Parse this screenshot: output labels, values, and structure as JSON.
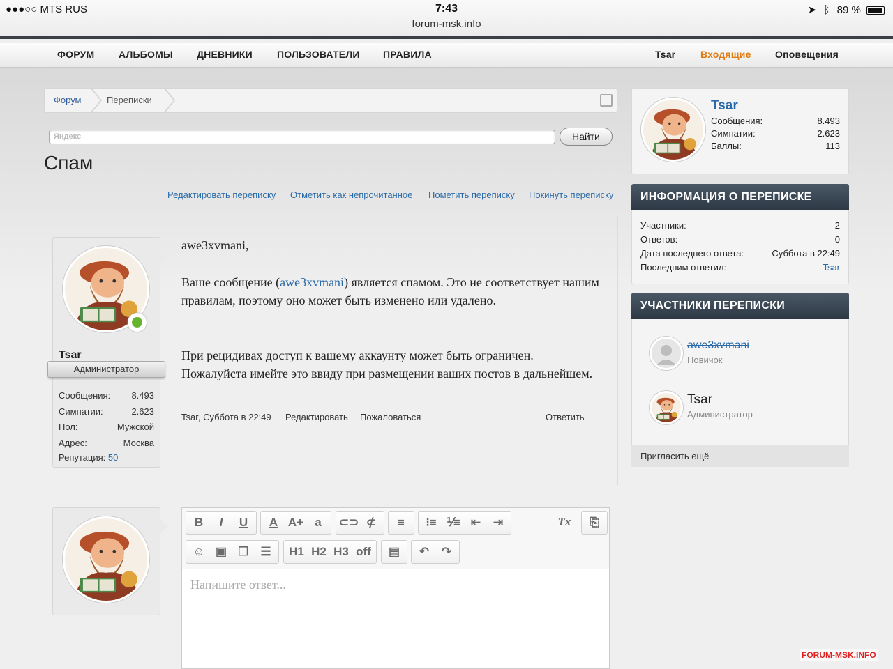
{
  "status_bar": {
    "carrier": "●●●○○ MTS RUS",
    "time": "7:43",
    "url": "forum-msk.info",
    "battery": "89 %",
    "battery_level": 0.89
  },
  "nav": {
    "items": [
      "ФОРУМ",
      "АЛЬБОМЫ",
      "ДНЕВНИКИ",
      "ПОЛЬЗОВАТЕЛИ",
      "ПРАВИЛА"
    ],
    "user": "Tsar",
    "inbox": "Входящие",
    "alerts": "Оповещения"
  },
  "breadcrumb": {
    "forum": "Форум",
    "conversations": "Переписки"
  },
  "search": {
    "placeholder": "Яндекс",
    "button": "Найти"
  },
  "page_title": "Спам",
  "actions": [
    "Редактировать переписку",
    "Отметить как непрочитанное",
    "Пометить переписку",
    "Покинуть переписку"
  ],
  "author": {
    "name": "Tsar",
    "role": "Администратор",
    "stats": [
      {
        "label": "Сообщения:",
        "value": "8.493"
      },
      {
        "label": "Симпатии:",
        "value": "2.623"
      },
      {
        "label": "Пол:",
        "value": "Мужской"
      },
      {
        "label": "Адрес:",
        "value": "Москва"
      }
    ],
    "reputation_label": "Репутация:",
    "reputation_value": "50"
  },
  "post": {
    "greeting": "awe3xvmani,",
    "p1_before": "Ваше сообщение (",
    "p1_link": "awe3xvmani",
    "p1_after": ") является спамом. Это не соответствует нашим правилам, поэтому оно может быть изменено или удалено.",
    "p2": "При рецидивах доступ к вашему аккаунту может быть ограничен. Пожалуйста имейте это ввиду при размещении ваших постов в дальнейшем.",
    "meta": "Tsar, Суббота в 22:49",
    "edit": "Редактировать",
    "report": "Пожаловаться",
    "reply": "Ответить"
  },
  "editor": {
    "placeholder": "Напишите ответ...",
    "toolbar": [
      "B",
      "I",
      "U",
      "A",
      "A+",
      "a",
      "link",
      "unlink",
      "align",
      "ul",
      "ol",
      "outdent",
      "indent",
      "Tx",
      "draft",
      "smilie",
      "image",
      "media",
      "quote",
      "H1",
      "H2",
      "H3",
      "off",
      "save",
      "undo",
      "redo"
    ]
  },
  "sidebar": {
    "profile": {
      "name": "Tsar",
      "stats": [
        {
          "label": "Сообщения:",
          "value": "8.493"
        },
        {
          "label": "Симпатии:",
          "value": "2.623"
        },
        {
          "label": "Баллы:",
          "value": "113"
        }
      ]
    },
    "info": {
      "title": "ИНФОРМАЦИЯ О ПЕРЕПИСКЕ",
      "rows": [
        {
          "label": "Участники:",
          "value": "2"
        },
        {
          "label": "Ответов:",
          "value": "0"
        },
        {
          "label": "Дата последнего ответа:",
          "value": "Суббота в 22:49"
        },
        {
          "label": "Последним ответил:",
          "value": "Tsar"
        }
      ]
    },
    "participants": {
      "title": "УЧАСТНИКИ ПЕРЕПИСКИ",
      "list": [
        {
          "name": "awe3xvmani",
          "role": "Новичок"
        },
        {
          "name": "Tsar",
          "role": "Администратор"
        }
      ],
      "invite": "Пригласить ещё"
    }
  },
  "watermark": "FORUM-MSK.INFO",
  "colors": {
    "link": "#2a6aa8",
    "accent_orange": "#e07b10",
    "online": "#64b42d",
    "header_dark": "#2d3844"
  }
}
